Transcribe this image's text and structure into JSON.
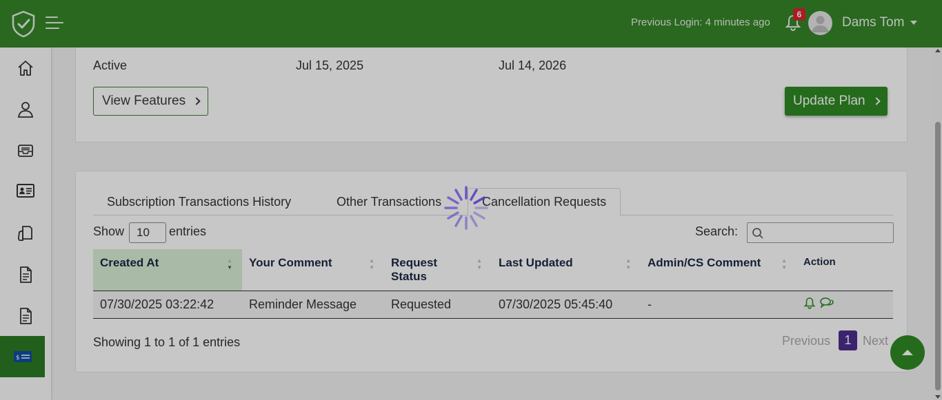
{
  "header": {
    "previous_login": "Previous Login: 4 minutes ago",
    "notification_count": "6",
    "user_name": "Dams Tom"
  },
  "sidebar": {
    "items": [
      {
        "icon": "home-icon"
      },
      {
        "icon": "user-icon"
      },
      {
        "icon": "inbox-icon"
      },
      {
        "icon": "id-card-icon"
      },
      {
        "icon": "hand-document-icon"
      },
      {
        "icon": "document-icon"
      },
      {
        "icon": "document-icon"
      },
      {
        "icon": "billing-icon",
        "active": true
      }
    ]
  },
  "plan": {
    "status": "Active",
    "start_date": "Jul 15, 2025",
    "end_date": "Jul 14, 2026",
    "view_features_label": "View Features",
    "update_plan_label": "Update Plan"
  },
  "tabs": [
    {
      "label": "Subscription Transactions History"
    },
    {
      "label": "Other Transactions"
    },
    {
      "label": "Cancellation Requests",
      "active": true
    }
  ],
  "table_controls": {
    "show_label": "Show",
    "entries_value": "10",
    "entries_label": "entries",
    "search_label": "Search:",
    "search_value": ""
  },
  "table": {
    "columns": [
      "Created At",
      "Your Comment",
      "Request Status",
      "Last Updated",
      "Admin/CS Comment",
      "Action"
    ],
    "rows": [
      [
        "07/30/2025 03:22:42",
        "Reminder Message",
        "Requested",
        "07/30/2025 05:45:40",
        "-"
      ]
    ]
  },
  "footer": {
    "showing": "Showing 1 to 1 of 1 entries",
    "previous": "Previous",
    "page": "1",
    "next": "Next"
  },
  "colors": {
    "brand_green": "#36862a",
    "page_active": "#4d2d8e",
    "badge_red": "#d9262e",
    "spinner": "#5b3fc4"
  }
}
